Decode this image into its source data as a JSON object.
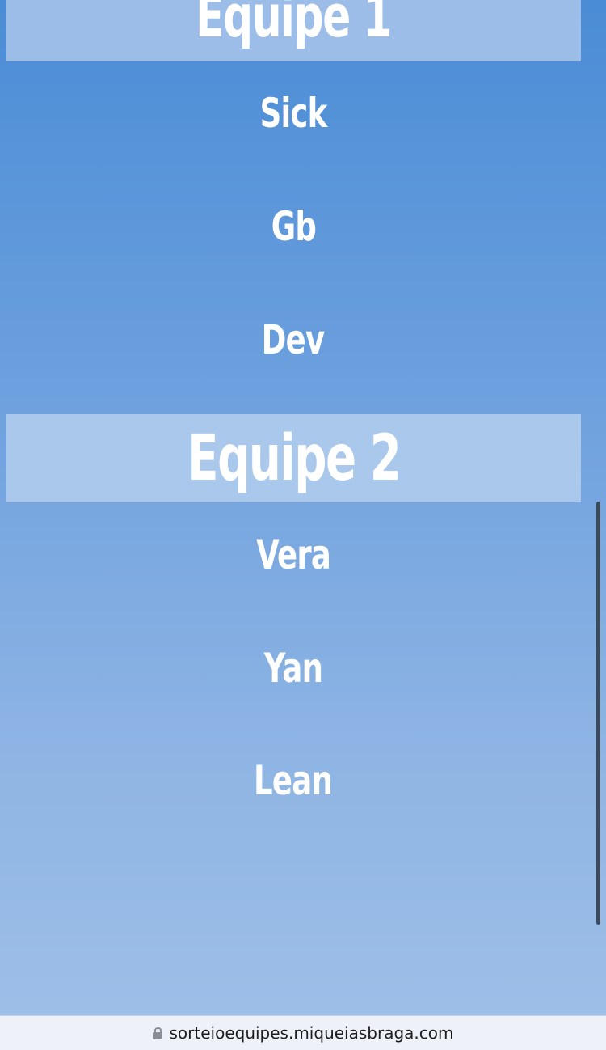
{
  "teams": [
    {
      "title": "Equipe 1",
      "players": [
        "Sick",
        "Gb",
        "Dev"
      ]
    },
    {
      "title": "Equipe 2",
      "players": [
        "Vera",
        "Yan",
        "Lean"
      ]
    }
  ],
  "browser": {
    "url": "sorteioequipes.miqueiasbraga.com",
    "lock_icon": "lock-icon"
  },
  "colors": {
    "background_top": "#4a8cd6",
    "background_bottom": "#9dbee7",
    "text": "#ffffff"
  }
}
